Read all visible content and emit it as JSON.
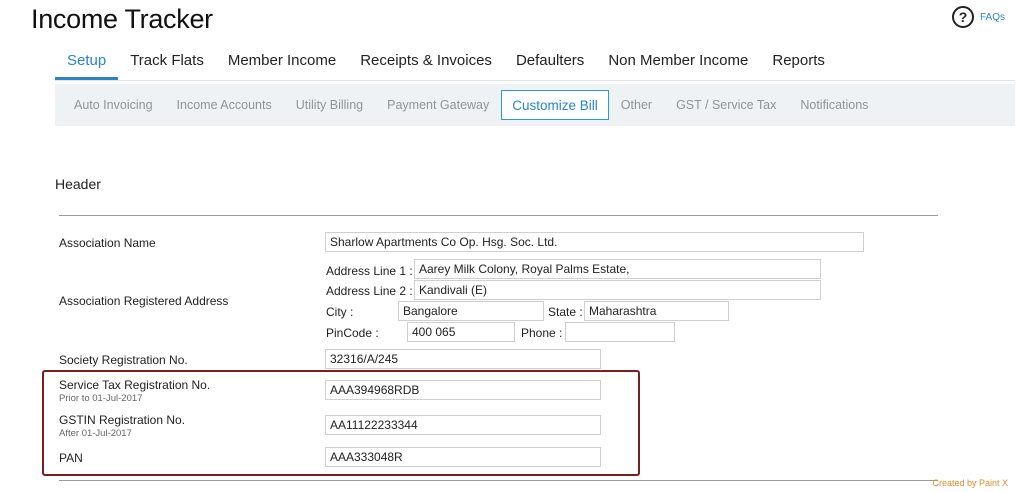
{
  "app": {
    "title": "Income Tracker",
    "faq_label": "FAQs",
    "faq_icon": "question-circle-icon"
  },
  "tabs": [
    {
      "label": "Setup",
      "active": true
    },
    {
      "label": "Track Flats"
    },
    {
      "label": "Member Income"
    },
    {
      "label": "Receipts & Invoices"
    },
    {
      "label": "Defaulters"
    },
    {
      "label": "Non Member Income"
    },
    {
      "label": "Reports"
    }
  ],
  "subtabs": [
    {
      "label": "Auto Invoicing"
    },
    {
      "label": "Income Accounts"
    },
    {
      "label": "Utility Billing"
    },
    {
      "label": "Payment Gateway"
    },
    {
      "label": "Customize Bill",
      "active": true
    },
    {
      "label": "Other"
    },
    {
      "label": "GST / Service Tax"
    },
    {
      "label": "Notifications"
    }
  ],
  "section": {
    "title": "Header"
  },
  "form": {
    "association_name": {
      "label": "Association Name",
      "value": "Sharlow Apartments Co Op. Hsg. Soc. Ltd."
    },
    "address": {
      "label": "Association Registered Address",
      "line1_label": "Address Line 1 :",
      "line1_value": "Aarey Milk Colony, Royal Palms Estate,",
      "line2_label": "Address Line 2 :",
      "line2_value": "Kandivali (E)",
      "city_label": "City :",
      "city_value": "Bangalore",
      "state_label": "State :",
      "state_value": "Maharashtra",
      "pincode_label": "PinCode :",
      "pincode_value": "400 065",
      "phone_label": "Phone :",
      "phone_value": ""
    },
    "society_reg": {
      "label": "Society Registration No.",
      "value": "32316/A/245"
    },
    "service_tax": {
      "label": "Service Tax Registration No.",
      "note": "Prior to 01-Jul-2017",
      "value": "AAA394968RDB"
    },
    "gstin": {
      "label": "GSTIN Registration No.",
      "note": "After 01-Jul-2017",
      "value": "AA11122233344"
    },
    "pan": {
      "label": "PAN",
      "value": "AAA333048R"
    }
  },
  "footer": {
    "credit": "Created by Paint X"
  },
  "colors": {
    "accent": "#2a84c6",
    "highlight_border": "#7a1f1f",
    "credit": "#e28a2b"
  }
}
